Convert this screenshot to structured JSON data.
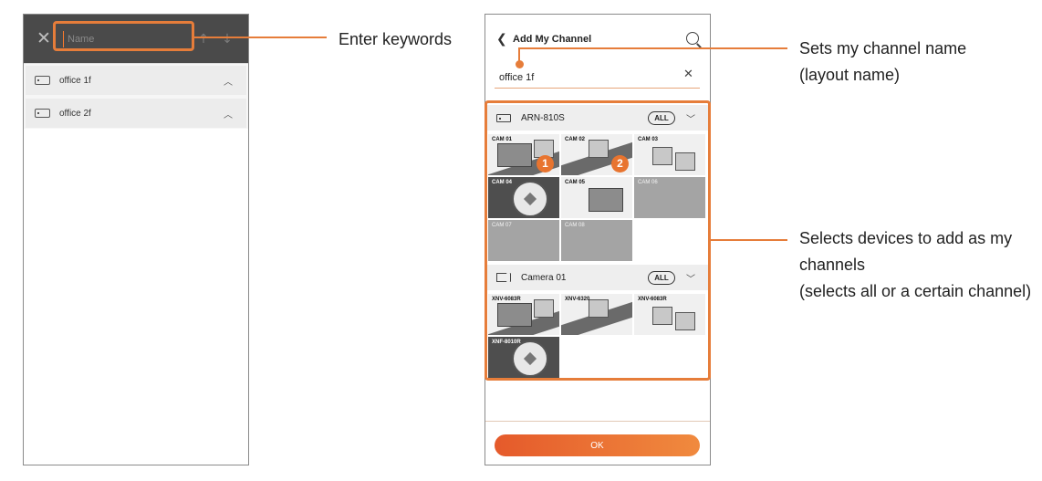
{
  "left_screen": {
    "close_icon": "close-icon",
    "search_placeholder": "Name",
    "items": [
      {
        "label": "office 1f"
      },
      {
        "label": "office 2f"
      }
    ]
  },
  "right_screen": {
    "title": "Add My Channel",
    "channel_name_value": "office 1f",
    "groups": [
      {
        "label": "ARN-810S",
        "all_label": "ALL",
        "channels": [
          "CAM 01",
          "CAM 02",
          "CAM 03",
          "CAM 04",
          "CAM 05",
          "CAM 06",
          "CAM 07",
          "CAM 08"
        ]
      },
      {
        "label": "Camera 01",
        "all_label": "ALL",
        "channels": [
          "XNV-6083R",
          "XNV-6320",
          "XNV-6083R",
          "XNF-8010R"
        ]
      }
    ],
    "badges": [
      "1",
      "2"
    ],
    "ok_label": "OK"
  },
  "callouts": {
    "keywords": "Enter keywords",
    "channel_name_line1": "Sets my channel name",
    "channel_name_line2": "(layout name)",
    "devices_line1": "Selects devices to add as my",
    "devices_line2": "channels",
    "devices_line3": "(selects all or a certain channel)"
  },
  "colors": {
    "accent": "#e67d3a",
    "header_dark": "#4a4a4a"
  }
}
